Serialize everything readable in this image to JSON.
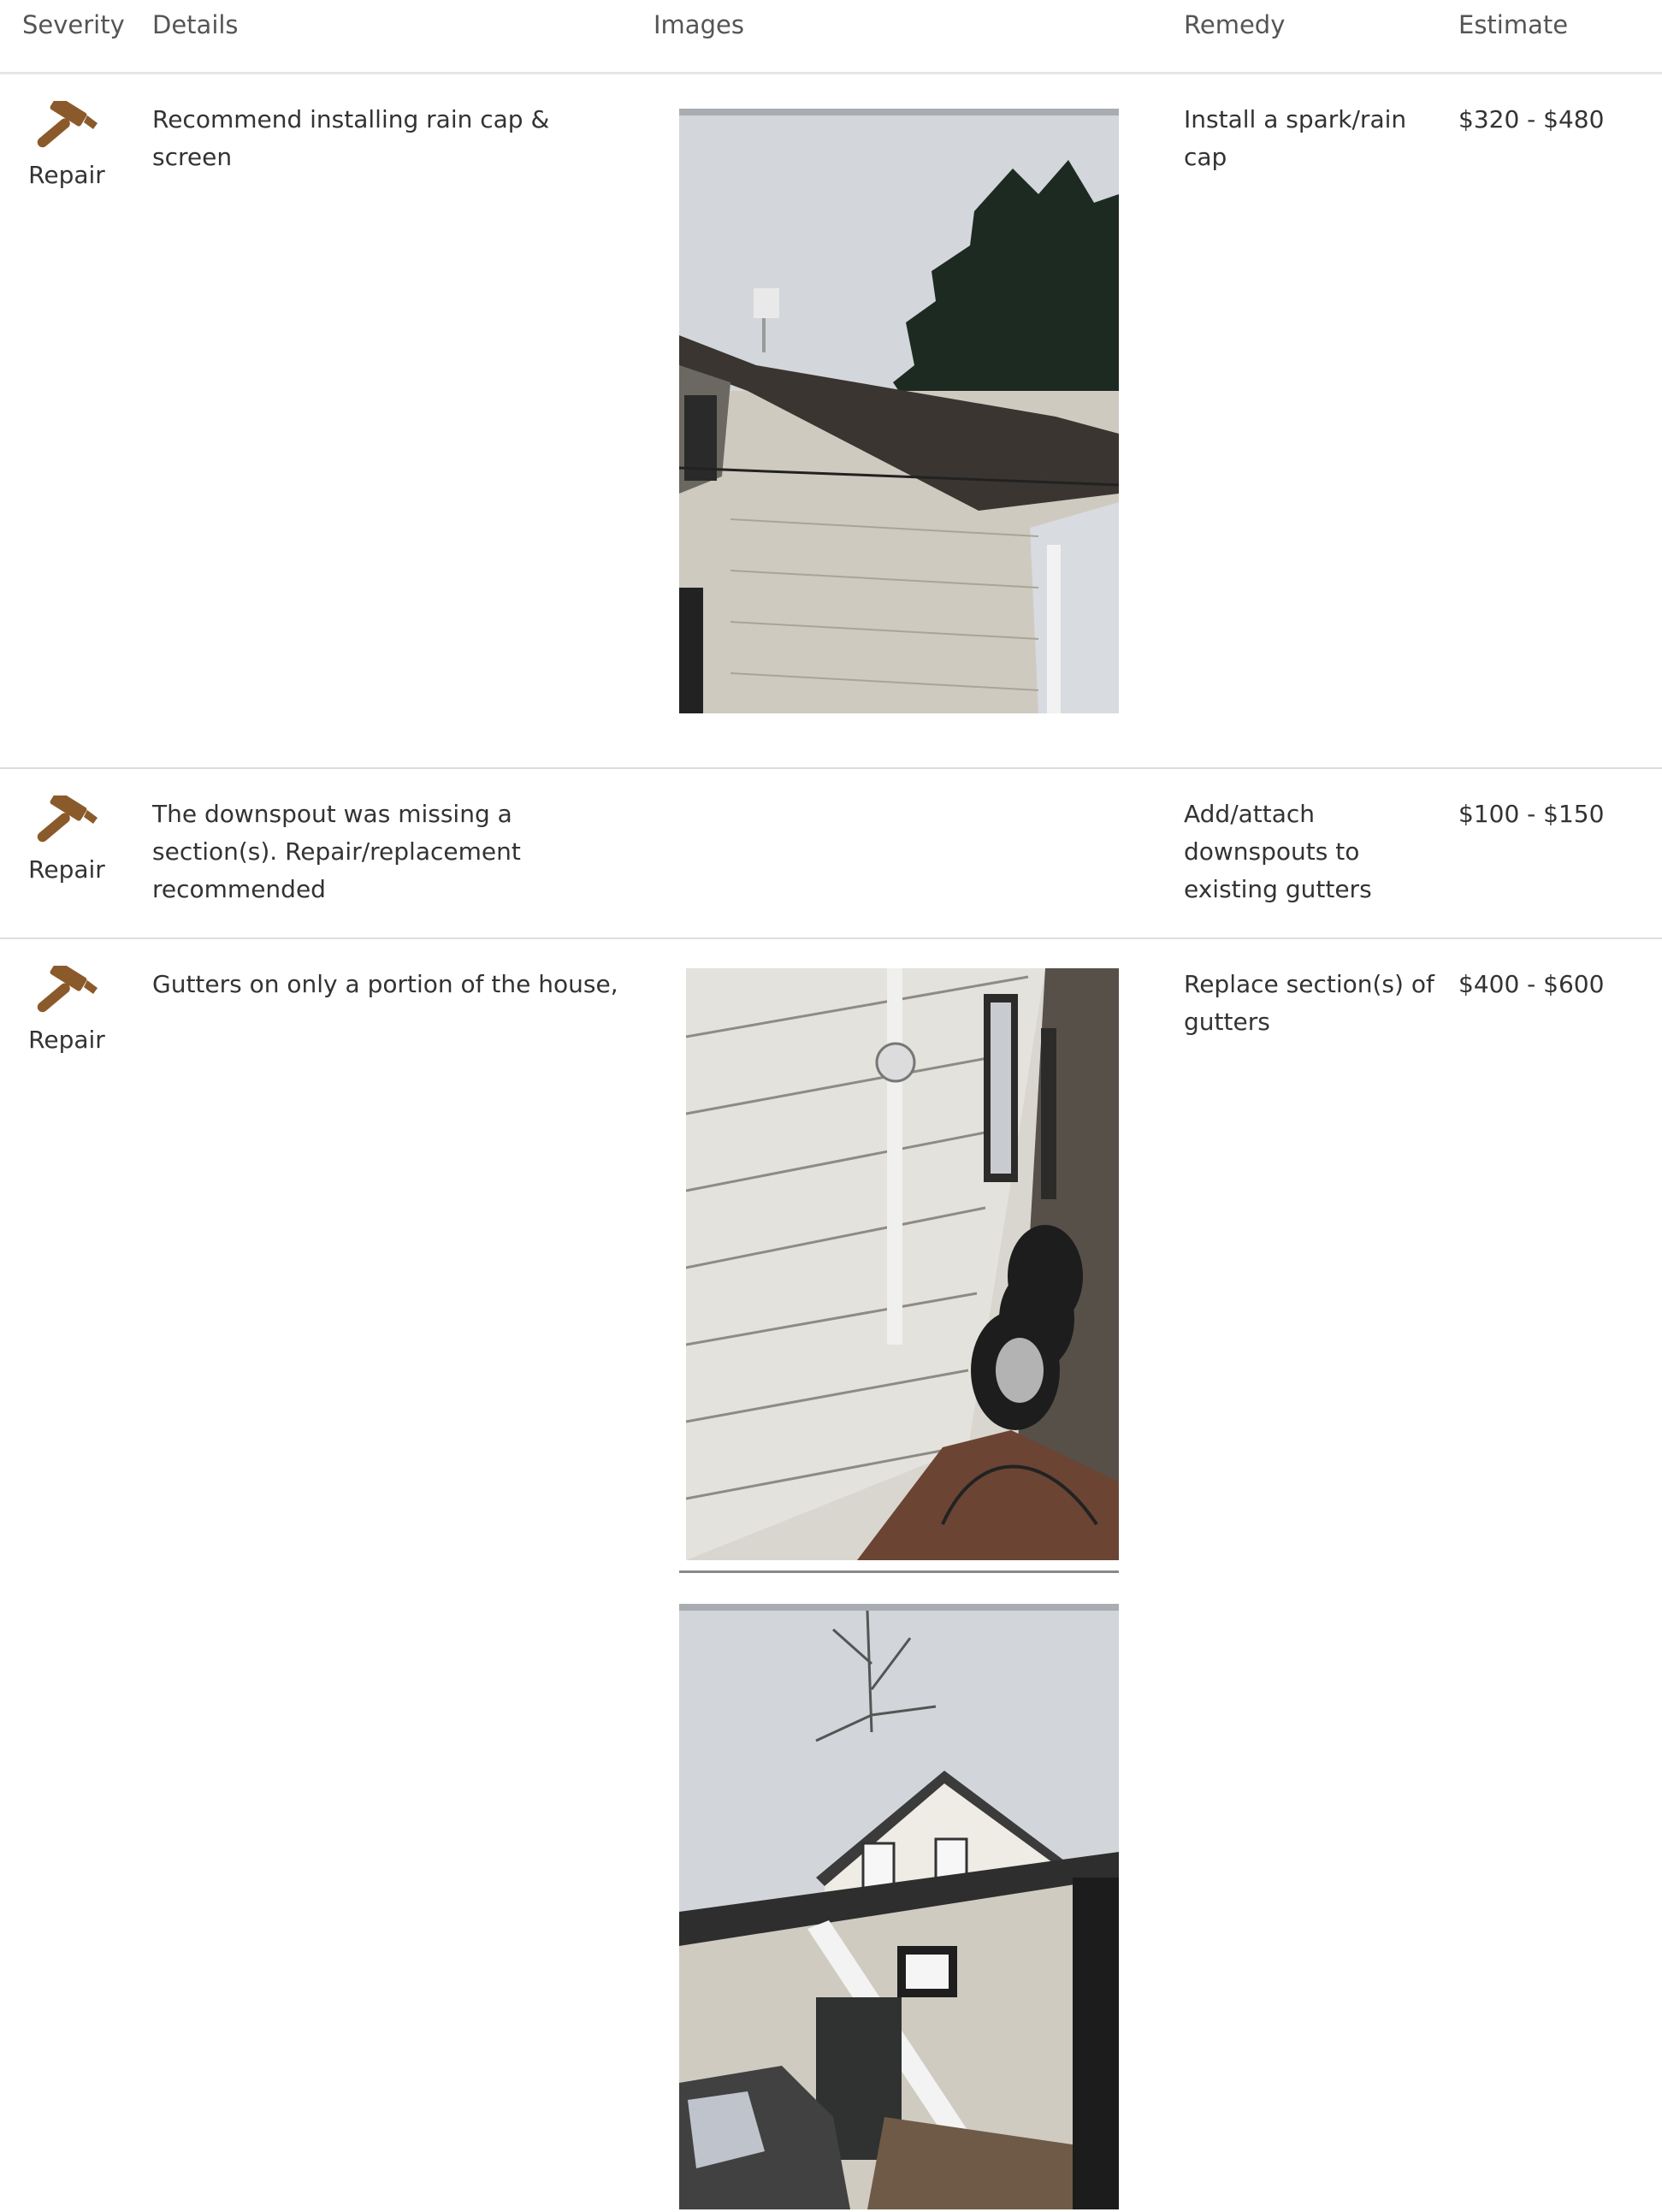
{
  "table": {
    "headers": {
      "severity": "Severity",
      "details": "Details",
      "images": "Images",
      "remedy": "Remedy",
      "estimate": "Estimate"
    },
    "accent_color": "#8b5a2b",
    "rows": [
      {
        "severity": "Repair",
        "severity_icon": "hammer-icon",
        "details": "Recommend installing rain cap & screen",
        "remedy": "Install a spark/rain cap",
        "estimate": "$320 - $480"
      },
      {
        "severity": "Repair",
        "severity_icon": "hammer-icon",
        "details": "The downspout was missing a section(s). Repair/replacement recommended",
        "remedy": "Add/attach downspouts to existing gutters",
        "estimate": "$100 - $150"
      },
      {
        "severity": "Repair",
        "severity_icon": "hammer-icon",
        "details": "Gutters on only a portion of the house,",
        "remedy": "Replace section(s) of gutters",
        "estimate": "$400 - $600"
      }
    ]
  }
}
